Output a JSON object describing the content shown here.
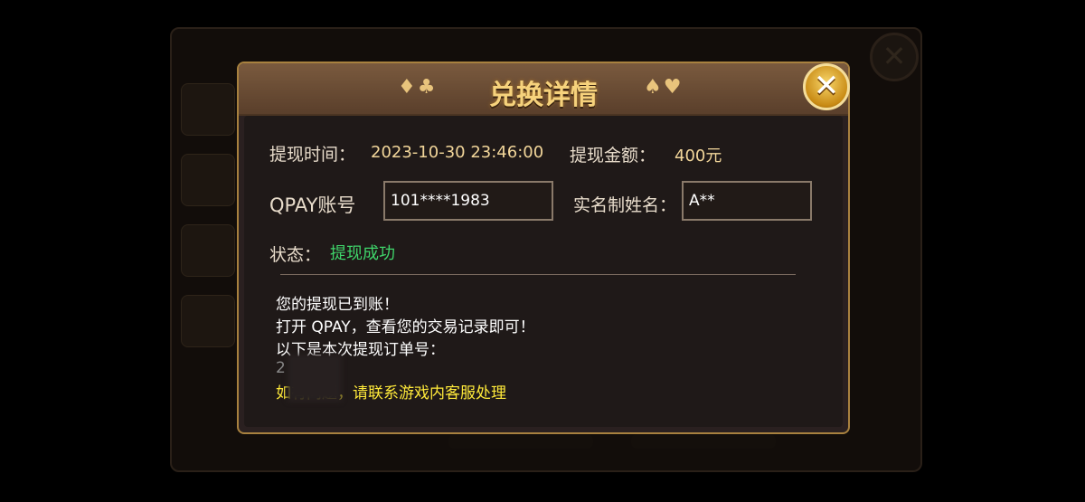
{
  "dialog": {
    "title": "兑换详情",
    "suits_left": "♦♣",
    "suits_right": "♠♥",
    "close_glyph": "✕",
    "withdraw_time_label": "提现时间：",
    "withdraw_time_value": "2023-10-30 23:46:00",
    "withdraw_amount_label": "提现金额：",
    "withdraw_amount_value": "400元",
    "qpay_label": "QPAY账号",
    "qpay_value": "101****1983",
    "real_name_label": "实名制姓名：",
    "real_name_value": "A**",
    "status_label": "状态：",
    "status_value": "提现成功",
    "messages": [
      "您的提现已到账！",
      "打开 QPAY，查看您的交易记录即可！",
      "以下是本次提现订单号：",
      "2",
      "如有问题，请联系游戏内客服处理"
    ]
  },
  "colors": {
    "accent_gold": "#f6d27c",
    "status_green": "#3fd46a",
    "notice_yellow": "#ffea3a"
  }
}
